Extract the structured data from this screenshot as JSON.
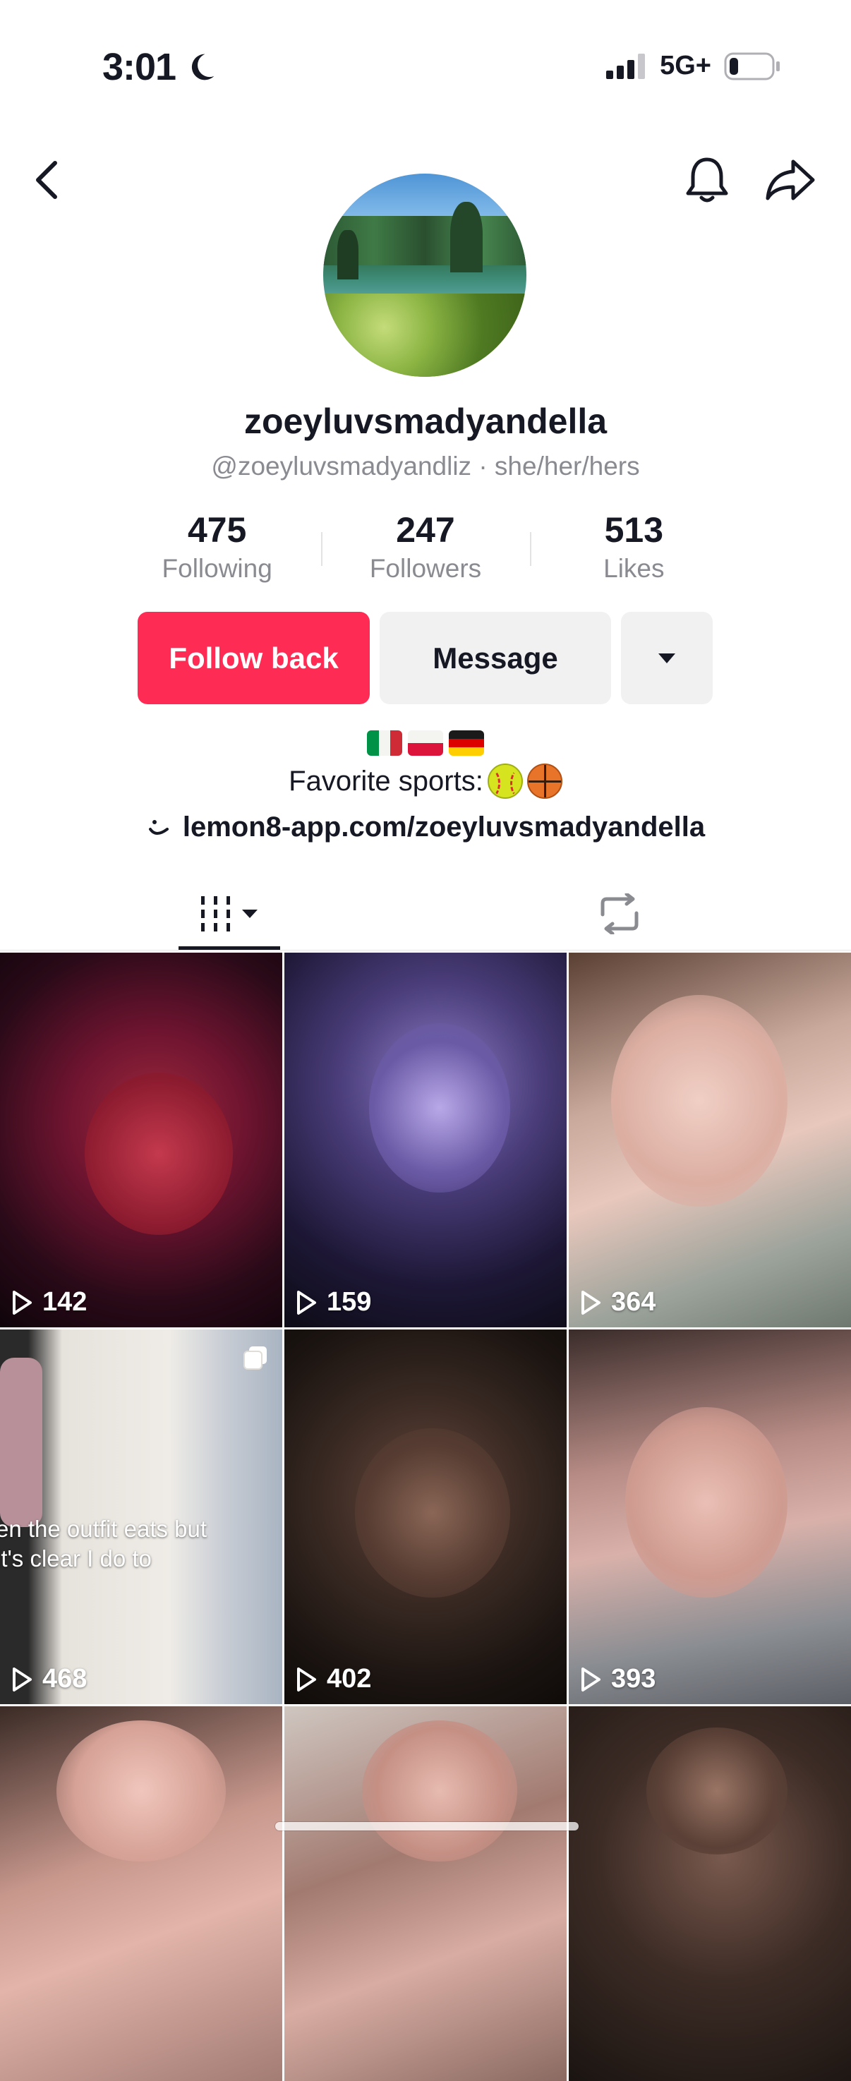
{
  "status_bar": {
    "time": "3:01",
    "network": "5G+"
  },
  "profile": {
    "display_name": "zoeyluvsmadyandella",
    "handle_line": "@zoeyluvsmadyandliz · she/her/hers",
    "stats": [
      {
        "value": "475",
        "label": "Following"
      },
      {
        "value": "247",
        "label": "Followers"
      },
      {
        "value": "513",
        "label": "Likes"
      }
    ],
    "buttons": {
      "follow": "Follow back",
      "message": "Message"
    },
    "bio": {
      "flags": [
        "Italy flag",
        "Poland flag",
        "Germany flag"
      ],
      "line": "Favorite sports:",
      "emojis": [
        "softball",
        "basketball"
      ],
      "link": "lemon8-app.com/zoeyluvsmadyandella"
    }
  },
  "videos": [
    {
      "views": "142"
    },
    {
      "views": "159"
    },
    {
      "views": "364"
    },
    {
      "views": "468",
      "caption": [
        "en the outfit eats but",
        "it's clear I do to"
      ]
    },
    {
      "views": "402"
    },
    {
      "views": "393"
    },
    {},
    {},
    {}
  ],
  "colors": {
    "accent": "#fe2c55",
    "text": "#161823",
    "secondary": "#8a8b91"
  }
}
